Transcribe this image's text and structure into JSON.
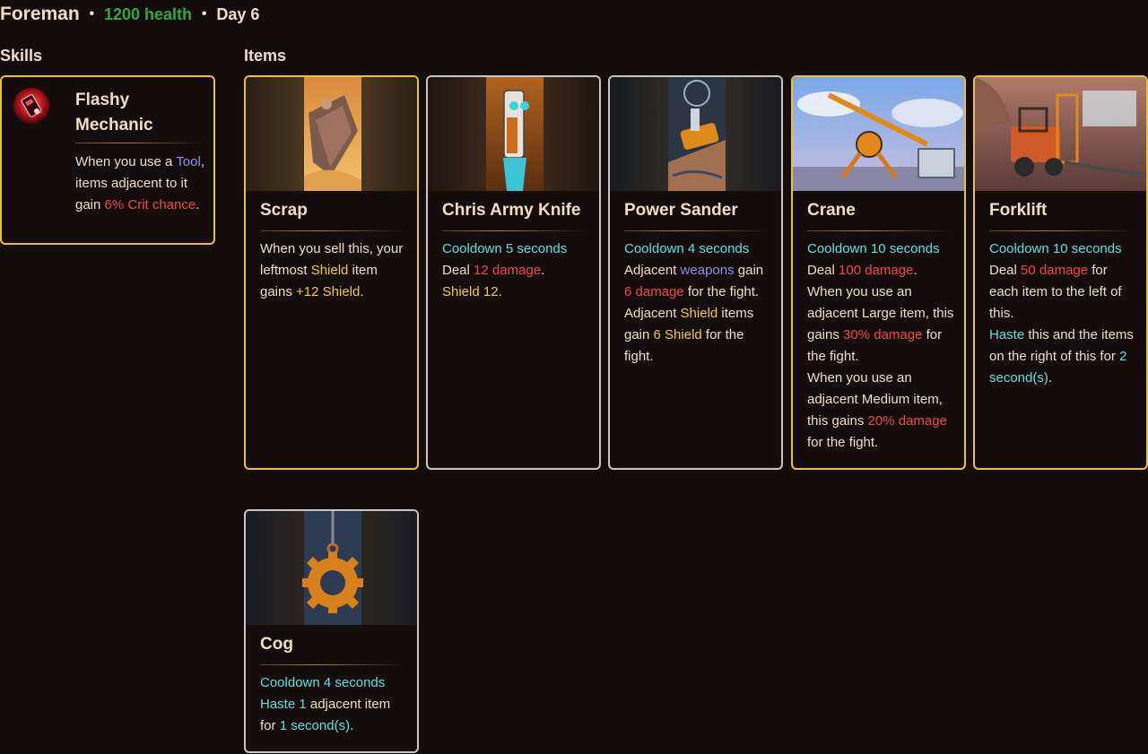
{
  "header": {
    "title": "Foreman",
    "separator": "•",
    "health": "1200 health",
    "day": "Day 6",
    "health_color": "#2fa74a"
  },
  "skills_section": {
    "title": "Skills",
    "skills": [
      {
        "name": "Flashy Mechanic",
        "icon": "flashy-mechanic-icon",
        "desc": [
          "When you use a ",
          "Tool",
          ", items adjacent to it gain ",
          "6% Crit chance",
          "."
        ]
      }
    ]
  },
  "items_section": {
    "title": "Items",
    "items": [
      {
        "name": "Scrap",
        "image": "scrap-image",
        "tier": "gold",
        "lines": [
          [
            "When you sell this, your leftmost ",
            "Shield",
            " item gains ",
            "+12 Shield",
            "."
          ]
        ]
      },
      {
        "name": "Chris Army Knife",
        "image": "chris-army-knife-image",
        "tier": "silver",
        "lines": [
          [
            "Cooldown ",
            "5",
            " seconds"
          ],
          [
            "Deal ",
            "12 damage",
            "."
          ],
          [
            "Shield",
            " ",
            "12",
            "."
          ]
        ]
      },
      {
        "name": "Power Sander",
        "image": "power-sander-image",
        "tier": "silver",
        "lines": [
          [
            "Cooldown ",
            "4",
            " seconds"
          ],
          [
            "Adjacent ",
            "weapons",
            " gain ",
            "6 damage",
            " for the fight."
          ],
          [
            "Adjacent ",
            "Shield",
            " items gain ",
            "6 Shield",
            " for the fight."
          ]
        ]
      },
      {
        "name": "Crane",
        "image": "crane-image",
        "tier": "gold",
        "lines": [
          [
            "Cooldown ",
            "10",
            " seconds"
          ],
          [
            "Deal ",
            "100 damage",
            "."
          ],
          [
            "When you use an adjacent Large item, this gains ",
            "30% damage",
            " for the fight."
          ],
          [
            "When you use an adjacent Medium item, this gains ",
            "20% damage",
            " for the fight."
          ]
        ]
      },
      {
        "name": "Forklift",
        "image": "forklift-image",
        "tier": "gold",
        "lines": [
          [
            "Cooldown ",
            "10",
            " seconds"
          ],
          [
            "Deal ",
            "50 damage",
            " for each item to the left of this."
          ],
          [
            "Haste",
            " this and the items on the right of this for ",
            "2",
            " second(s)",
            "."
          ]
        ]
      },
      {
        "name": "Cog",
        "image": "cog-image",
        "tier": "silver",
        "lines": [
          [
            "Cooldown ",
            "4",
            " seconds"
          ],
          [
            "Haste",
            " ",
            "1",
            " adjacent item for ",
            "1",
            " second(s)",
            "."
          ]
        ]
      }
    ]
  },
  "colors": {
    "background": "#150d0c",
    "gold_border": "#e8c33a",
    "silver_border": "#c9c7c5",
    "cooldown": "#5fe0dc",
    "damage": "#ef4a43",
    "shield": "#f1ca3f",
    "tag": "#8c93ee"
  }
}
